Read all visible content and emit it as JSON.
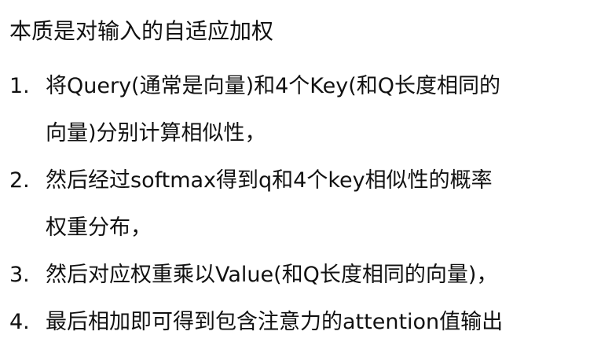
{
  "title": "本质是对输入的自适应加权",
  "items": [
    {
      "number": "1.",
      "lines": [
        "将Query(通常是向量)和4个Key(和Q长度相同的",
        "向量)分别计算相似性，"
      ]
    },
    {
      "number": "2.",
      "lines": [
        "然后经过softmax得到q和4个key相似性的概率",
        "权重分布，"
      ]
    },
    {
      "number": "3.",
      "lines": [
        "然后对应权重乘以Value(和Q长度相同的向量)，"
      ]
    },
    {
      "number": "4.",
      "lines": [
        "最后相加即可得到包含注意力的attention值输出"
      ]
    }
  ]
}
